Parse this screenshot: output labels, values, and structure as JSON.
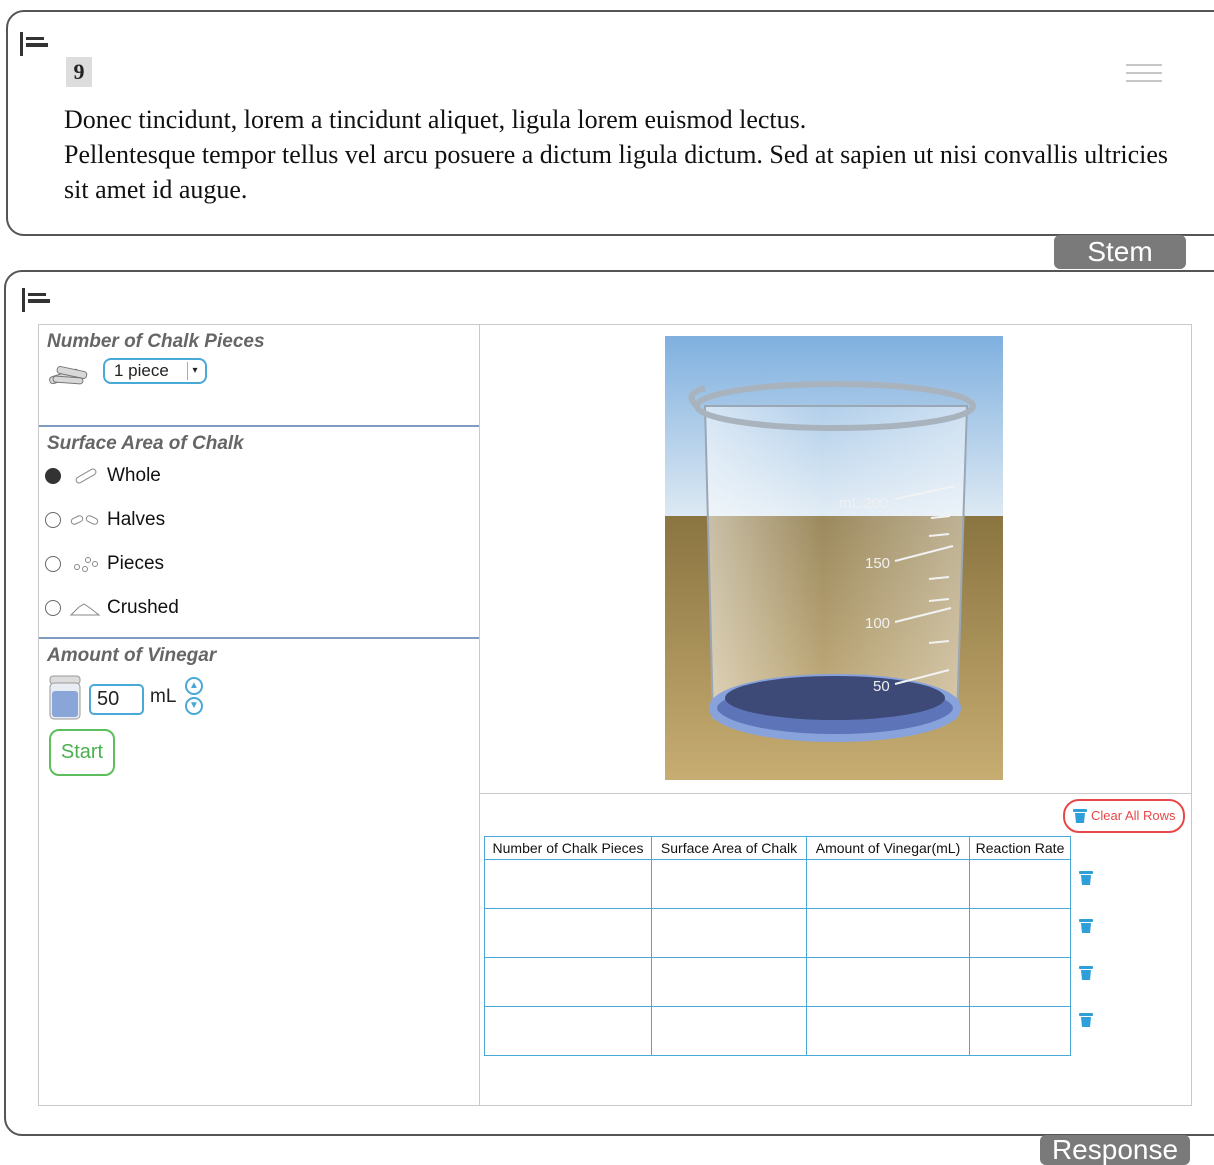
{
  "stem": {
    "number": "9",
    "lines": [
      "Donec tincidunt, lorem a tincidunt aliquet, ligula lorem euismod lectus.",
      "Pellentesque tempor tellus vel arcu posuere a dictum ligula dictum. Sed at sapien ut nisi convallis ultricies sit amet id augue."
    ],
    "tab_label": "Stem"
  },
  "response": {
    "tab_label": "Response"
  },
  "controls": {
    "chalk_pieces": {
      "title": "Number of Chalk Pieces",
      "selected": "1 piece"
    },
    "surface_area": {
      "title": "Surface Area of Chalk",
      "options": [
        {
          "label": "Whole",
          "selected": true
        },
        {
          "label": "Halves",
          "selected": false
        },
        {
          "label": "Pieces",
          "selected": false
        },
        {
          "label": "Crushed",
          "selected": false
        }
      ]
    },
    "vinegar": {
      "title": "Amount of Vinegar",
      "value": "50",
      "unit": "mL"
    },
    "start_label": "Start"
  },
  "beaker": {
    "marks": [
      "mL 200",
      "150",
      "100",
      "50"
    ]
  },
  "table": {
    "clear_label": "Clear All Rows",
    "columns": [
      "Number of Chalk Pieces",
      "Surface Area of Chalk",
      "Amount of Vinegar(mL)",
      "Reaction Rate"
    ],
    "rows": [
      [
        "",
        "",
        "",
        ""
      ],
      [
        "",
        "",
        "",
        ""
      ],
      [
        "",
        "",
        "",
        ""
      ],
      [
        "",
        "",
        "",
        ""
      ]
    ]
  },
  "colors": {
    "accent": "#4aa8d8",
    "start": "#4caf50",
    "danger": "#e84848"
  }
}
